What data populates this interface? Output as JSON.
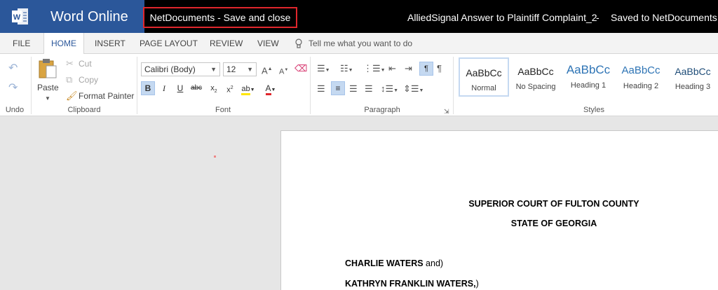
{
  "titlebar": {
    "app_name": "Word Online",
    "netdocs_button": "NetDocuments - Save and close",
    "doc_title": "AlliedSignal Answer to Plaintiff Complaint_2",
    "separator": "-",
    "save_status": "Saved to NetDocuments"
  },
  "tabs": [
    "FILE",
    "HOME",
    "INSERT",
    "PAGE LAYOUT",
    "REVIEW",
    "VIEW"
  ],
  "active_tab": "HOME",
  "tell_me": "Tell me what you want to do",
  "ribbon": {
    "undo_group": "Undo",
    "clipboard": {
      "label": "Clipboard",
      "paste": "Paste",
      "cut": "Cut",
      "copy": "Copy",
      "format_painter": "Format Painter"
    },
    "font": {
      "label": "Font",
      "family": "Calibri (Body)",
      "size": "12"
    },
    "paragraph": {
      "label": "Paragraph"
    },
    "styles": {
      "label": "Styles",
      "items": [
        {
          "sample": "AaBbCc",
          "name": "Normal"
        },
        {
          "sample": "AaBbCc",
          "name": "No Spacing"
        },
        {
          "sample": "AaBbCc",
          "name": "Heading 1"
        },
        {
          "sample": "AaBbCc",
          "name": "Heading 2"
        },
        {
          "sample": "AaBbCc",
          "name": "Heading 3"
        }
      ]
    }
  },
  "document": {
    "court_line1": "SUPERIOR COURT OF FULTON COUNTY",
    "court_line2": "STATE OF GEORGIA",
    "party1_name": "CHARLIE WATERS",
    "party1_rest": " and)",
    "party2_name": "KATHRYN FRANKLIN WATERS,",
    "party2_rest": ")"
  },
  "colors": {
    "brand_blue": "#2b579a",
    "titlebar_bg": "#000000",
    "highlight_border": "#e0262c",
    "accent": "#2b579a"
  }
}
